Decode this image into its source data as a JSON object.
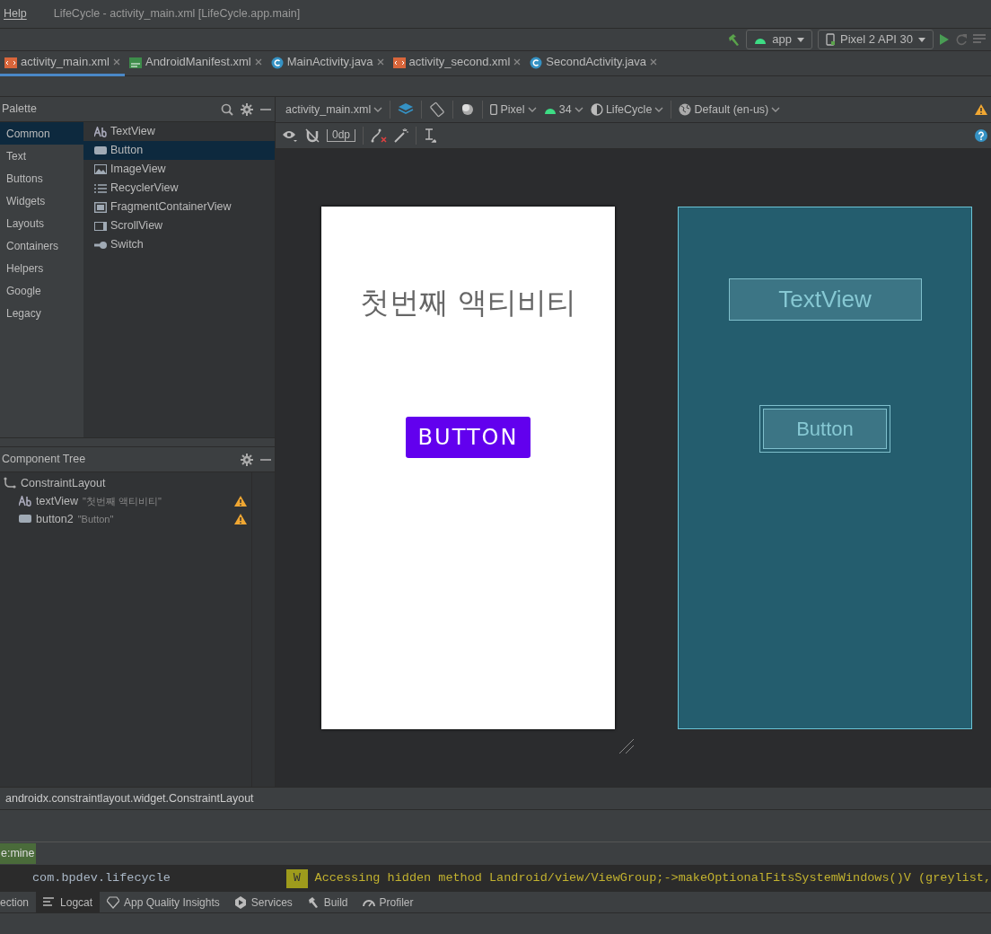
{
  "menu": [
    {
      "label": "Help"
    }
  ],
  "window": {
    "title": "LifeCycle - activity_main.xml [LifeCycle.app.main]"
  },
  "run_toolbar": {
    "config": "app",
    "device": "Pixel 2 API 30"
  },
  "tabs": [
    {
      "label": "activity_main.xml",
      "kind": "xml",
      "selected": true
    },
    {
      "label": "AndroidManifest.xml",
      "kind": "manifest",
      "selected": false
    },
    {
      "label": "MainActivity.java",
      "kind": "class",
      "selected": false
    },
    {
      "label": "activity_second.xml",
      "kind": "xml",
      "selected": false
    },
    {
      "label": "SecondActivity.java",
      "kind": "class",
      "selected": false
    }
  ],
  "palette": {
    "title": "Palette",
    "categories": [
      {
        "label": "Common",
        "selected": true
      },
      {
        "label": "Text",
        "selected": false
      },
      {
        "label": "Buttons",
        "selected": false
      },
      {
        "label": "Widgets",
        "selected": false
      },
      {
        "label": "Layouts",
        "selected": false
      },
      {
        "label": "Containers",
        "selected": false
      },
      {
        "label": "Helpers",
        "selected": false
      },
      {
        "label": "Google",
        "selected": false
      },
      {
        "label": "Legacy",
        "selected": false
      }
    ],
    "items": [
      {
        "label": "TextView",
        "kind": "text",
        "selected": false
      },
      {
        "label": "Button",
        "kind": "button",
        "selected": true
      },
      {
        "label": "ImageView",
        "kind": "image",
        "selected": false
      },
      {
        "label": "RecyclerView",
        "kind": "list",
        "selected": false
      },
      {
        "label": "FragmentContainerView",
        "kind": "fragment",
        "selected": false
      },
      {
        "label": "ScrollView",
        "kind": "scroll",
        "selected": false
      },
      {
        "label": "Switch",
        "kind": "switch",
        "selected": false
      }
    ]
  },
  "component_tree": {
    "title": "Component Tree",
    "nodes": [
      {
        "label": "ConstraintLayout",
        "kind": "layout",
        "children": [
          {
            "label": "textView",
            "kind": "text",
            "detail": "\"첫번째 액티비티\"",
            "warning": true
          },
          {
            "label": "button2",
            "kind": "button",
            "detail": "\"Button\"",
            "warning": true
          }
        ]
      }
    ]
  },
  "editor_toolbar": {
    "file": "activity_main.xml",
    "device": "Pixel",
    "api": "34",
    "theme": "LifeCycle",
    "locale": "Default (en-us)",
    "margin": "0dp"
  },
  "design": {
    "text": "첫번째 액티비티",
    "button": "BUTTON"
  },
  "blueprint": {
    "text": "TextView",
    "button": "Button"
  },
  "breadcrumb": "androidx.constraintlayout.widget.ConstraintLayout",
  "logcat": {
    "filter": "e:mine",
    "package": "com.bpdev.lifecycle",
    "level": "W",
    "message": "Accessing hidden method Landroid/view/ViewGroup;->makeOptionalFitsSystemWindows()V (greylist,"
  },
  "bottom_tabs": [
    {
      "label": "ection",
      "kind": "none",
      "selected": false
    },
    {
      "label": "Logcat",
      "kind": "logcat",
      "selected": true
    },
    {
      "label": "App Quality Insights",
      "kind": "gem",
      "selected": false
    },
    {
      "label": "Services",
      "kind": "services",
      "selected": false
    },
    {
      "label": "Build",
      "kind": "build",
      "selected": false
    },
    {
      "label": "Profiler",
      "kind": "profiler",
      "selected": false
    }
  ]
}
